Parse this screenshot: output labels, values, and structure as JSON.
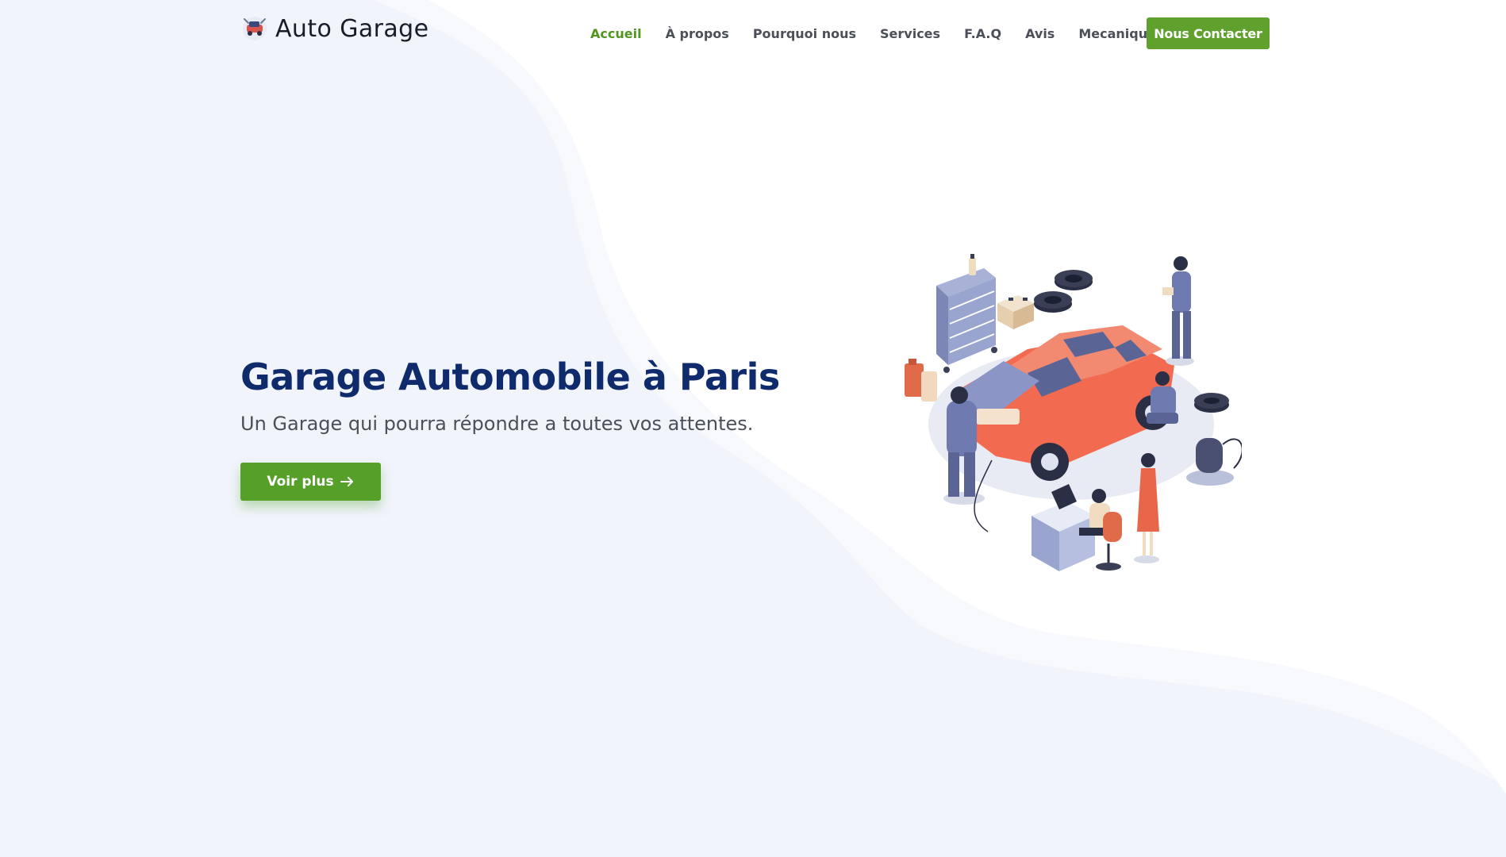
{
  "brand": {
    "name": "Auto Garage",
    "logo_icon": "car-wrench-icon"
  },
  "nav": {
    "items": [
      {
        "label": "Accueil",
        "active": true
      },
      {
        "label": "À propos",
        "active": false
      },
      {
        "label": "Pourquoi nous",
        "active": false
      },
      {
        "label": "Services",
        "active": false
      },
      {
        "label": "F.A.Q",
        "active": false
      },
      {
        "label": "Avis",
        "active": false
      },
      {
        "label": "Mecanique",
        "active": false,
        "has_dropdown": true
      }
    ],
    "cta_label": "Nous Contacter"
  },
  "hero": {
    "title": "Garage Automobile à Paris",
    "subtitle": "Un Garage qui pourra répondre a toutes vos attentes.",
    "button_label": "Voir plus",
    "button_icon": "arrow-right-icon",
    "illustration": "car-repair-illustration"
  },
  "colors": {
    "accent_green": "#5fa12c",
    "active_link": "#51961e",
    "title_blue": "#0f2b6b",
    "background": "#f1f4fb"
  }
}
